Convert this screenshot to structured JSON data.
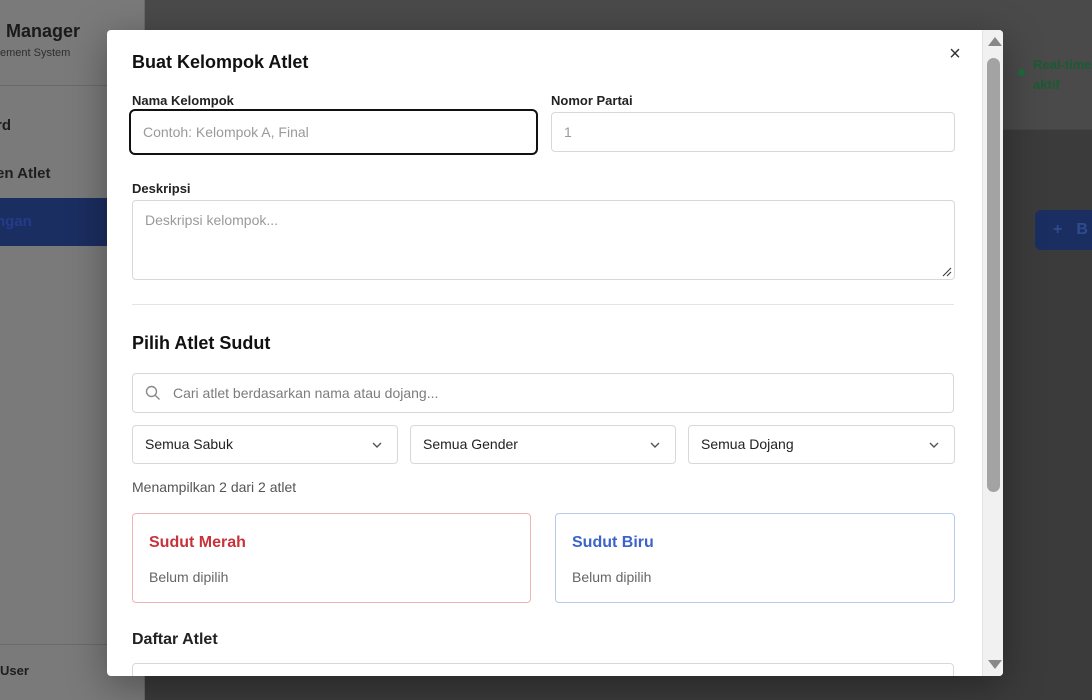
{
  "sidebar": {
    "brand_title": "Manager",
    "brand_subtitle": "ement System",
    "items": [
      {
        "label": "rd"
      },
      {
        "label": "en Atlet"
      },
      {
        "label": "ngan"
      }
    ],
    "footer_user": "User"
  },
  "header": {
    "status_line1": "Real-time",
    "status_line2": "aktif"
  },
  "background_button": {
    "label": "B"
  },
  "modal": {
    "title": "Buat Kelompok Atlet",
    "close_icon": "close-icon",
    "fields": {
      "group_name": {
        "label": "Nama Kelompok",
        "placeholder": "Contoh: Kelompok A, Final",
        "value": ""
      },
      "match_number": {
        "label": "Nomor Partai",
        "value": "1"
      },
      "description": {
        "label": "Deskripsi",
        "placeholder": "Deskripsi kelompok...",
        "value": ""
      }
    },
    "athlete_section": {
      "title": "Pilih Atlet Sudut",
      "search_placeholder": "Cari atlet berdasarkan nama atau dojang...",
      "filters": {
        "belt": "Semua Sabuk",
        "gender": "Semua Gender",
        "dojang": "Semua Dojang"
      },
      "result_count": "Menampilkan 2 dari 2 atlet",
      "red_corner": {
        "title": "Sudut Merah",
        "status": "Belum dipilih",
        "color": "#c8323a"
      },
      "blue_corner": {
        "title": "Sudut Biru",
        "status": "Belum dipilih",
        "color": "#3a64c8"
      },
      "list_title": "Daftar Atlet"
    }
  }
}
